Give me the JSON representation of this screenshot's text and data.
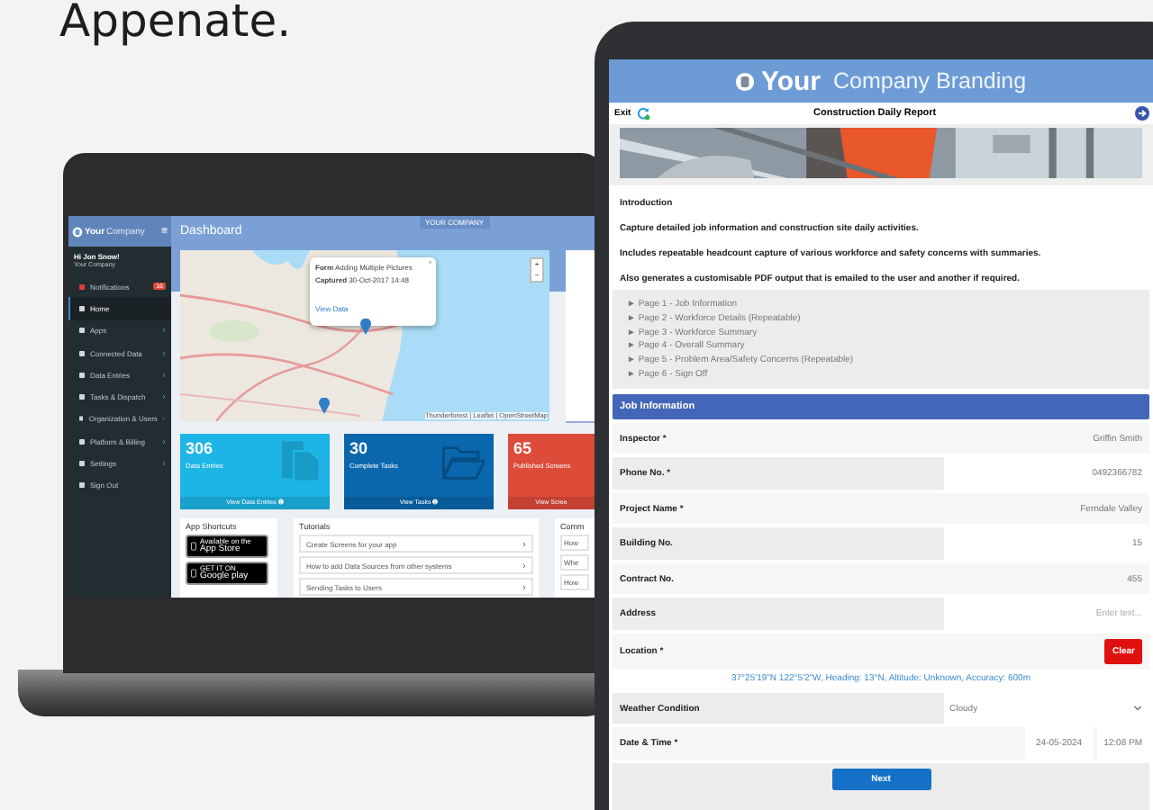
{
  "heading": "Appenate.",
  "laptop": {
    "brand": {
      "bold": "Your",
      "rest": "Company"
    },
    "menu": "≡",
    "user": {
      "greeting": "Hi Jon Snow!",
      "company": "Your Company"
    },
    "nav": [
      {
        "label": "Notifications",
        "badge": "16",
        "submenu": false,
        "selected": false
      },
      {
        "label": "Home",
        "submenu": false,
        "selected": true
      },
      {
        "label": "Apps",
        "submenu": true,
        "selected": false
      },
      {
        "label": "Connected Data",
        "submenu": true,
        "selected": false
      },
      {
        "label": "Data Entries",
        "submenu": true,
        "selected": false
      },
      {
        "label": "Tasks & Dispatch",
        "submenu": true,
        "selected": false
      },
      {
        "label": "Organization & Users",
        "submenu": true,
        "selected": false
      },
      {
        "label": "Platform & Billing",
        "submenu": true,
        "selected": false
      },
      {
        "label": "Settings",
        "submenu": true,
        "selected": false
      },
      {
        "label": "Sign Out",
        "submenu": false,
        "selected": false
      }
    ],
    "top_badge": "YOUR COMPANY",
    "page_title": "Dashboard",
    "map_popup": {
      "form_label": "Form",
      "form_value": "Adding Multiple Pictures",
      "captured_label": "Captured",
      "captured_value": "30-Oct-2017 14:48",
      "link": "View Data",
      "close": "×"
    },
    "zoom_buttons": [
      "+",
      "−"
    ],
    "attribution": "Thunderforest | Leaflet | OpenStreetMap",
    "stats": [
      {
        "value": "306",
        "label": "Data Entries",
        "link": "View Data Entries ➊",
        "color": "#1cb5e6",
        "kind": "document"
      },
      {
        "value": "30",
        "label": "Complete Tasks",
        "link": "View Tasks ➊",
        "color": "#0a67ad",
        "kind": "folder"
      },
      {
        "value": "65",
        "label": "Published Screens",
        "link": "View Scree",
        "color": "#dd4b39",
        "kind": "none"
      }
    ],
    "shortcuts": {
      "title": "App Shortcuts",
      "badges": [
        {
          "small": "Available on the",
          "big": "App Store"
        },
        {
          "small": "GET IT ON",
          "big": "Google play"
        }
      ]
    },
    "tutorials": {
      "title": "Tutorials",
      "items": [
        "Create Screens for your app",
        "How to add Data Sources from other systems",
        "Sending Tasks to Users"
      ]
    },
    "community": {
      "title": "Comm",
      "items": [
        "How",
        "Whe",
        "How"
      ]
    }
  },
  "tablet": {
    "brand": {
      "bold": "Your",
      "rest": "Company Branding"
    },
    "exit": "Exit",
    "title": "Construction Daily Report",
    "intro": [
      "Introduction",
      "Capture detailed job information and construction site daily activities.",
      "Includes repeatable headcount capture of various workforce and safety concerns with summaries.",
      "Also generates a customisable PDF output that is emailed to the user and another if required."
    ],
    "pages": [
      "► Page 1 - Job Information",
      "► Page 2 - Workforce Details (Repeatable)",
      "► Page 3 - Workforce Summary",
      "► Page 4 - Overall Summary",
      "► Page 5 - Problem Area/Safety Concerns (Repeatable)",
      "► Page 6 - Sign Off"
    ],
    "section": "Job Information",
    "fields": [
      {
        "kind": "text",
        "label": "Inspector *",
        "value": "Griffin Smith"
      },
      {
        "kind": "text",
        "label": "Phone No. *",
        "value": "0492366782"
      },
      {
        "kind": "text",
        "label": "Project Name *",
        "value": "Ferndale Valley"
      },
      {
        "kind": "text",
        "label": "Building No.",
        "value": "15"
      },
      {
        "kind": "text",
        "label": "Contract No.",
        "value": "455"
      },
      {
        "kind": "text",
        "label": "Address",
        "placeholder": "Enter text..."
      },
      {
        "kind": "location",
        "label": "Location *",
        "button": "Clear",
        "coords": "37°25'19\"N 122°5'2\"W, Heading: 13°N, Altitude: Unknown, Accuracy: 600m"
      },
      {
        "kind": "select",
        "label": "Weather Condition",
        "value": "Cloudy"
      },
      {
        "kind": "datetime",
        "label": "Date & Time *",
        "date": "24-05-2024",
        "time": "12:08 PM"
      }
    ],
    "next": "Next"
  }
}
